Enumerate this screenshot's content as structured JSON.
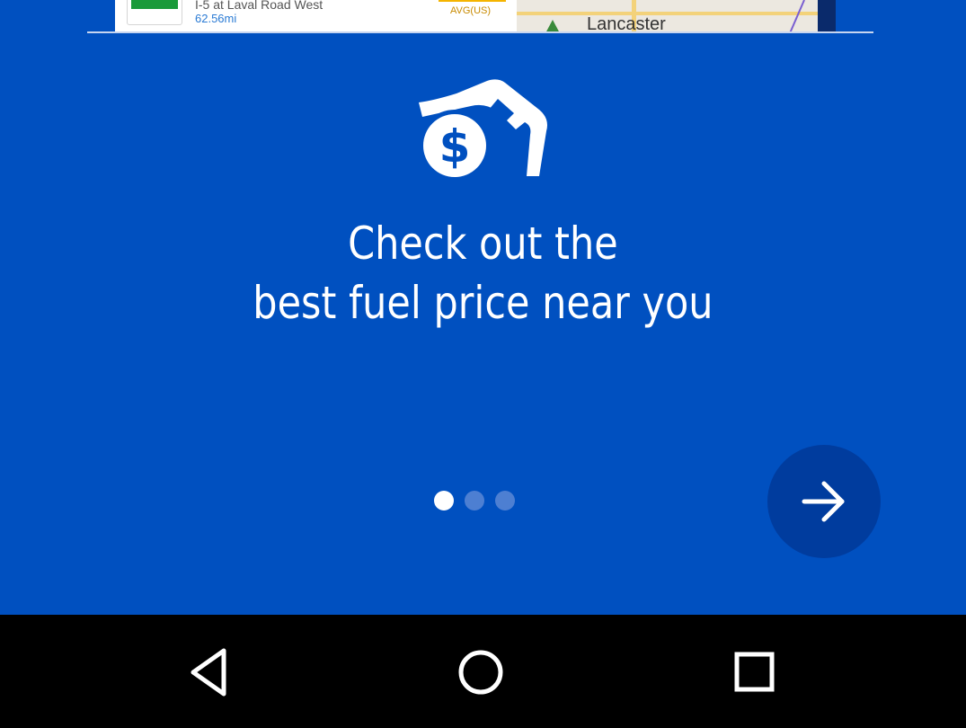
{
  "preview": {
    "address": "I-5 at Laval Road West",
    "distance": "62.56mi",
    "price_label": "AVG(US)",
    "map_label": "Lancaster"
  },
  "hero": {
    "icon": "fuel-nozzle-dollar-icon",
    "headline_line1": "Check out the",
    "headline_line2": "best fuel price near you"
  },
  "pager": {
    "current_page": 1,
    "total_pages": 3
  },
  "next_button": {
    "icon": "arrow-right-icon"
  },
  "navbar": {
    "back_icon": "back-triangle-icon",
    "home_icon": "home-circle-icon",
    "recents_icon": "recents-square-icon"
  },
  "colors": {
    "background": "#0050c0",
    "next_button": "#003c9e",
    "dot_active": "#ffffff",
    "dot_inactive": "#4d7fd2",
    "navbar": "#000000"
  }
}
